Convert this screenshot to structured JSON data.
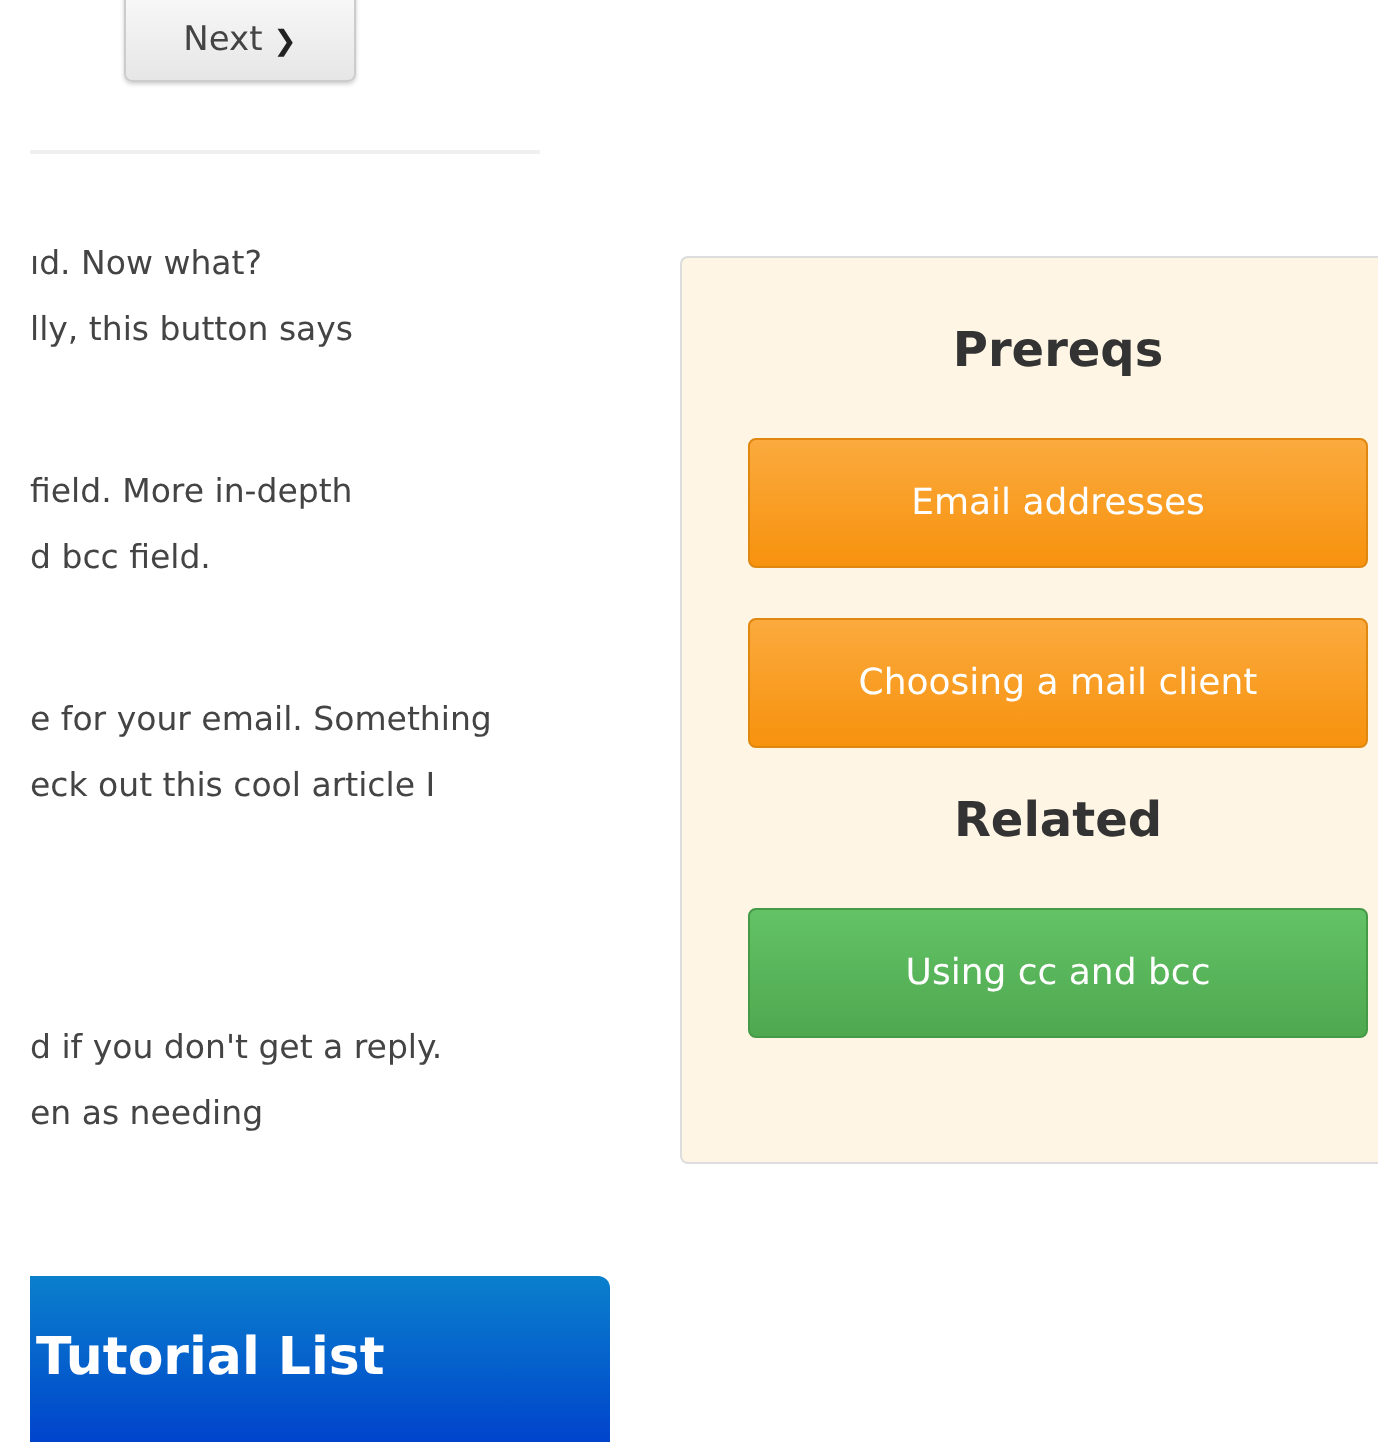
{
  "next_button": {
    "label": "Next",
    "icon": "❯"
  },
  "paragraphs": [
    {
      "lines": [
        "ıd. Now what?",
        "lly, this button says"
      ]
    },
    {
      "lines": [
        "field. More in-depth",
        "d bcc field."
      ]
    },
    {
      "lines": [
        "e for your email. Something",
        "eck out this cool article I"
      ]
    },
    {
      "lines": [
        "d if you don't get a reply.",
        "en as needing"
      ]
    }
  ],
  "sidebar": {
    "sections": [
      {
        "heading": "Prereqs",
        "links": [
          {
            "label": "Email addresses",
            "kind": "prereq"
          },
          {
            "label": "Choosing a mail client",
            "kind": "prereq"
          }
        ]
      },
      {
        "heading": "Related",
        "links": [
          {
            "label": "Using cc and bcc",
            "kind": "related"
          }
        ]
      }
    ]
  },
  "tutorial_list": {
    "title": "Tutorial List"
  }
}
